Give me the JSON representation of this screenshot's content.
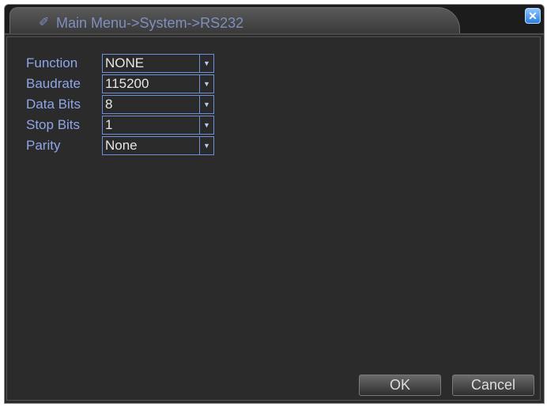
{
  "window": {
    "title": "Main Menu->System->RS232",
    "close_icon": "close-icon"
  },
  "fields": [
    {
      "label": "Function",
      "value": "NONE"
    },
    {
      "label": "Baudrate",
      "value": "115200"
    },
    {
      "label": "Data Bits",
      "value": "8"
    },
    {
      "label": "Stop Bits",
      "value": "1"
    },
    {
      "label": "Parity",
      "value": "None"
    }
  ],
  "buttons": {
    "ok_label": "OK",
    "cancel_label": "Cancel"
  },
  "colors": {
    "label_text": "#8fa6e8",
    "background": "#2b2b2b",
    "accent_border": "#6d8fd8"
  }
}
